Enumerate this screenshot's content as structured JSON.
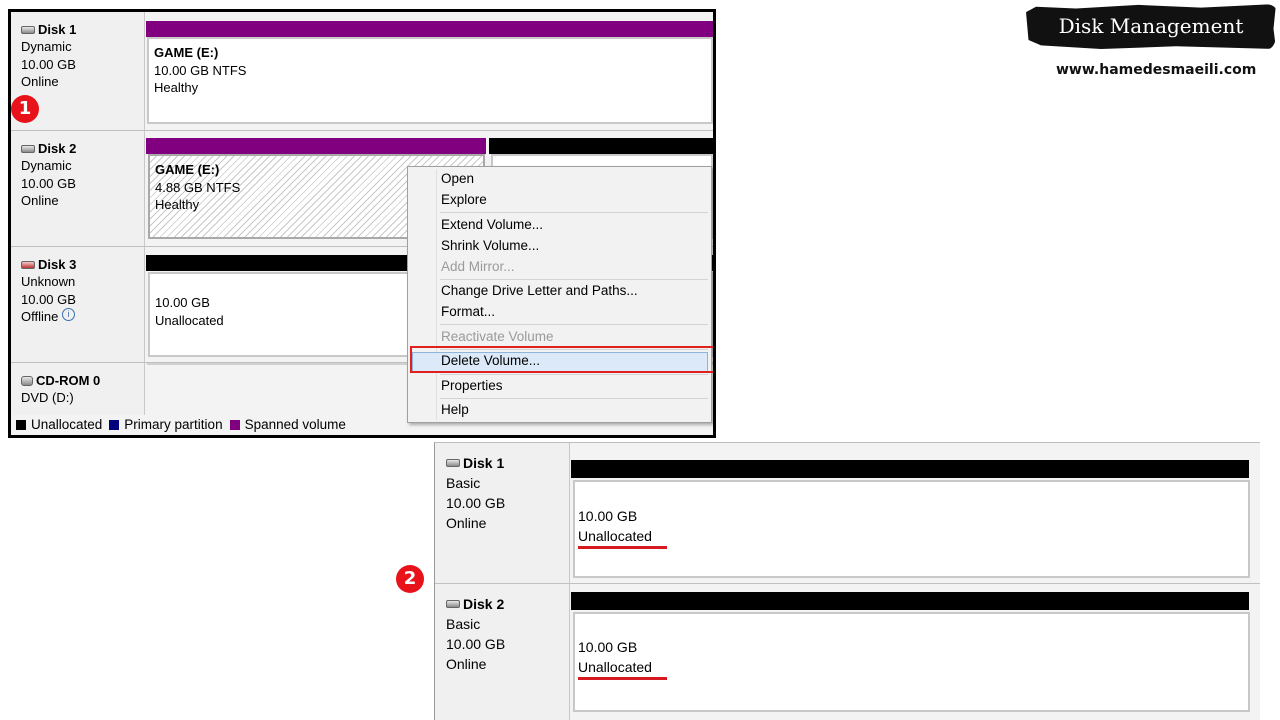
{
  "header": {
    "title": "Disk Management",
    "website": "www.hamedesmaeili.com"
  },
  "badges": {
    "step1": "1",
    "step2": "2"
  },
  "before": {
    "disks": [
      {
        "name": "Disk 1",
        "type": "Dynamic",
        "size": "10.00 GB",
        "status": "Online",
        "volume": {
          "title": "GAME  (E:)",
          "size": "10.00 GB NTFS",
          "health": "Healthy"
        }
      },
      {
        "name": "Disk 2",
        "type": "Dynamic",
        "size": "10.00 GB",
        "status": "Online",
        "volume": {
          "title": "GAME  (E:)",
          "size": "4.88 GB NTFS",
          "health": "Healthy"
        }
      },
      {
        "name": "Disk 3",
        "type": "Unknown",
        "size": "10.00 GB",
        "status": "Offline",
        "volume": {
          "size": "10.00 GB",
          "state": "Unallocated"
        }
      },
      {
        "name": "CD-ROM 0",
        "type": "DVD (D:)"
      }
    ],
    "context_menu": {
      "open": "Open",
      "explore": "Explore",
      "extend": "Extend Volume...",
      "shrink": "Shrink Volume...",
      "add_mirror": "Add Mirror...",
      "change_letter": "Change Drive Letter and Paths...",
      "format": "Format...",
      "reactivate": "Reactivate Volume",
      "delete": "Delete Volume...",
      "properties": "Properties",
      "help": "Help"
    },
    "legend": {
      "unallocated": "Unallocated",
      "primary": "Primary partition",
      "spanned": "Spanned volume"
    }
  },
  "after": {
    "disks": [
      {
        "name": "Disk 1",
        "type": "Basic",
        "size": "10.00 GB",
        "status": "Online",
        "volume": {
          "size": "10.00 GB",
          "state": "Unallocated"
        }
      },
      {
        "name": "Disk 2",
        "type": "Basic",
        "size": "10.00 GB",
        "status": "Online",
        "volume": {
          "size": "10.00 GB",
          "state": "Unallocated"
        }
      }
    ]
  },
  "colors": {
    "spanned": "#800080",
    "unallocated": "#000000",
    "primary": "#00007f",
    "highlight_frame": "#e0201c",
    "badge": "#e8131a"
  }
}
